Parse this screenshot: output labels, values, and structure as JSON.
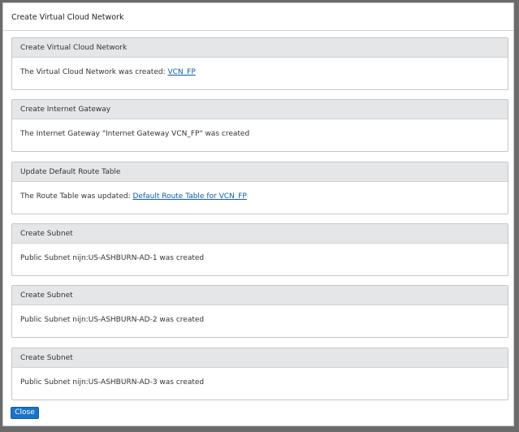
{
  "dialog": {
    "title": "Create Virtual Cloud Network"
  },
  "panels": [
    {
      "header": "Create Virtual Cloud Network",
      "text": "The Virtual Cloud Network was created: ",
      "link": "VCN_FP"
    },
    {
      "header": "Create Internet Gateway",
      "text": "The Internet Gateway \"Internet Gateway VCN_FP\" was created",
      "link": ""
    },
    {
      "header": "Update Default Route Table",
      "text": "The Route Table was updated: ",
      "link": "Default Route Table for VCN_FP"
    },
    {
      "header": "Create Subnet",
      "text": "Public Subnet nijn:US-ASHBURN-AD-1 was created",
      "link": ""
    },
    {
      "header": "Create Subnet",
      "text": "Public Subnet nijn:US-ASHBURN-AD-2 was created",
      "link": ""
    },
    {
      "header": "Create Subnet",
      "text": "Public Subnet nijn:US-ASHBURN-AD-3 was created",
      "link": ""
    }
  ],
  "footer": {
    "close_label": "Close"
  },
  "colors": {
    "panel_header_bg": "#e4e6e8",
    "link": "#0b5cab",
    "primary_button": "#1a73c8"
  }
}
